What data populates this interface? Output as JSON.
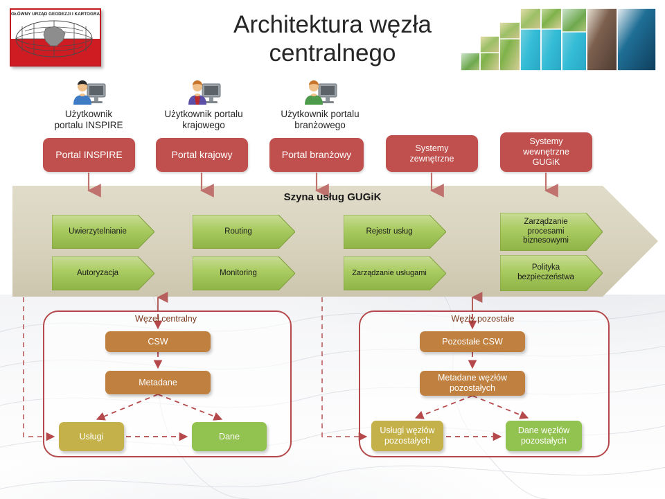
{
  "slide": {
    "title_line1": "Architektura węzła",
    "title_line2": "centralnego",
    "logo_text": "GŁÓWNY URZĄD GEODEZJI I KARTOGRAFII"
  },
  "colors": {
    "red_box": "#C0504D",
    "band_beige": "#D9D3BE",
    "chevron_green": "#9BBB59",
    "brown_box": "#C08040",
    "olive_box": "#C5B14A",
    "green_box": "#92C24F",
    "group_border": "#B5484A",
    "group_title": "#7B3A1E",
    "logo_red": "#CF1B22"
  },
  "users": [
    {
      "id": "inspire",
      "label_line1": "Użytkownik",
      "label_line2": "portalu INSPIRE",
      "icon": "user-computer-icon",
      "shirt": "#3f7bc4",
      "hair": "#2b2b2b"
    },
    {
      "id": "krajowy",
      "label_line1": "Użytkownik portalu",
      "label_line2": "krajowego",
      "icon": "user-computer-icon",
      "shirt": "#5b4fa8",
      "hair": "#c8742a"
    },
    {
      "id": "branzowy",
      "label_line1": "Użytkownik portalu",
      "label_line2": "branżowego",
      "icon": "user-computer-icon",
      "shirt": "#4d9a4d",
      "hair": "#c8742a"
    }
  ],
  "top_boxes": [
    {
      "id": "portal-inspire",
      "label": "Portal INSPIRE"
    },
    {
      "id": "portal-krajowy",
      "label": "Portal krajowy"
    },
    {
      "id": "portal-branzowy",
      "label": "Portal branżowy"
    },
    {
      "id": "systemy-zewnetrzne",
      "label": "Systemy\nzewnętrzne"
    },
    {
      "id": "systemy-wewnetrzne",
      "label": "Systemy\nwewnętrzne\nGUGiK"
    }
  ],
  "bus": {
    "label": "Szyna usług GUGiK",
    "services_row1": [
      {
        "id": "uwierzytelnianie",
        "label": "Uwierzytelnianie"
      },
      {
        "id": "routing",
        "label": "Routing"
      },
      {
        "id": "rejestr-uslug",
        "label": "Rejestr usług"
      },
      {
        "id": "zarzadzanie-procesami",
        "label": "Zarządzanie\nprocesami\nbiznesowymi"
      }
    ],
    "services_row2": [
      {
        "id": "autoryzacja",
        "label": "Autoryzacja"
      },
      {
        "id": "monitoring",
        "label": "Monitoring"
      },
      {
        "id": "zarzadzanie-uslugami",
        "label": "Zarządzanie usługami"
      },
      {
        "id": "polityka-bezpieczenstwa",
        "label": "Polityka\nbezpieczeństwa"
      }
    ]
  },
  "groups": [
    {
      "id": "wezel-centralny",
      "title": "Węzeł centralny",
      "nodes": {
        "csw": "CSW",
        "metadane": "Metadane",
        "uslugi": "Usługi",
        "dane": "Dane"
      }
    },
    {
      "id": "wezly-pozostale",
      "title": "Węzły pozostałe",
      "nodes": {
        "csw": "Pozostałe CSW",
        "metadane": "Metadane węzłów\npozostałych",
        "uslugi": "Usługi węzłów\npozostałych",
        "dane": "Dane węzłów\npozostałych"
      }
    }
  ]
}
